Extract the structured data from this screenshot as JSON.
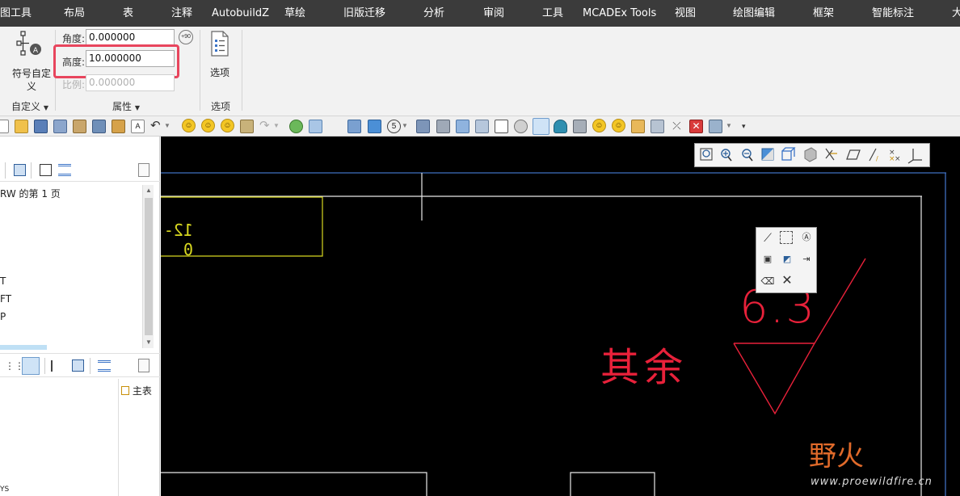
{
  "menu": {
    "items": [
      "图工具",
      "布局",
      "表",
      "注释",
      "AutobuildZ",
      "草绘",
      "旧版迁移",
      "分析",
      "审阅",
      "工具",
      "MCADEx Tools",
      "视图",
      "绘图编辑",
      "框架",
      "智能标注",
      "大"
    ]
  },
  "ribbon": {
    "custom_group": {
      "button_label": "符号自定义",
      "group_label": "自定义",
      "icon": "custom-symbol-icon"
    },
    "properties_group": {
      "angle_label": "角度:",
      "angle_value": "0.000000",
      "angle_step_label": "+90",
      "height_label": "高度:",
      "height_value": "10.000000",
      "scale_label": "比例:",
      "scale_value": "0.000000",
      "group_label": "属性"
    },
    "options_group": {
      "button_label": "选项",
      "group_label": "选项",
      "icon": "options-list-icon"
    }
  },
  "left_panel": {
    "page_label": "RW 的第 1 页",
    "list_items": [
      "T",
      "FT",
      "P"
    ],
    "main_table_label": "主表",
    "bottom_item": "YS"
  },
  "canvas": {
    "title_block_text": "12-0",
    "roughness_value": "6.3",
    "roughness_note": "其余",
    "watermark_logo": "野火",
    "watermark_url": "www.proewildfire.cn"
  },
  "colors": {
    "menubar_bg": "#3b3b3b",
    "highlight": "#e8455d",
    "canvas_bg": "#000000",
    "annotation_red": "#e8213a",
    "frame_yellow": "#d8d820",
    "frame_blue": "#3f6fc0"
  }
}
